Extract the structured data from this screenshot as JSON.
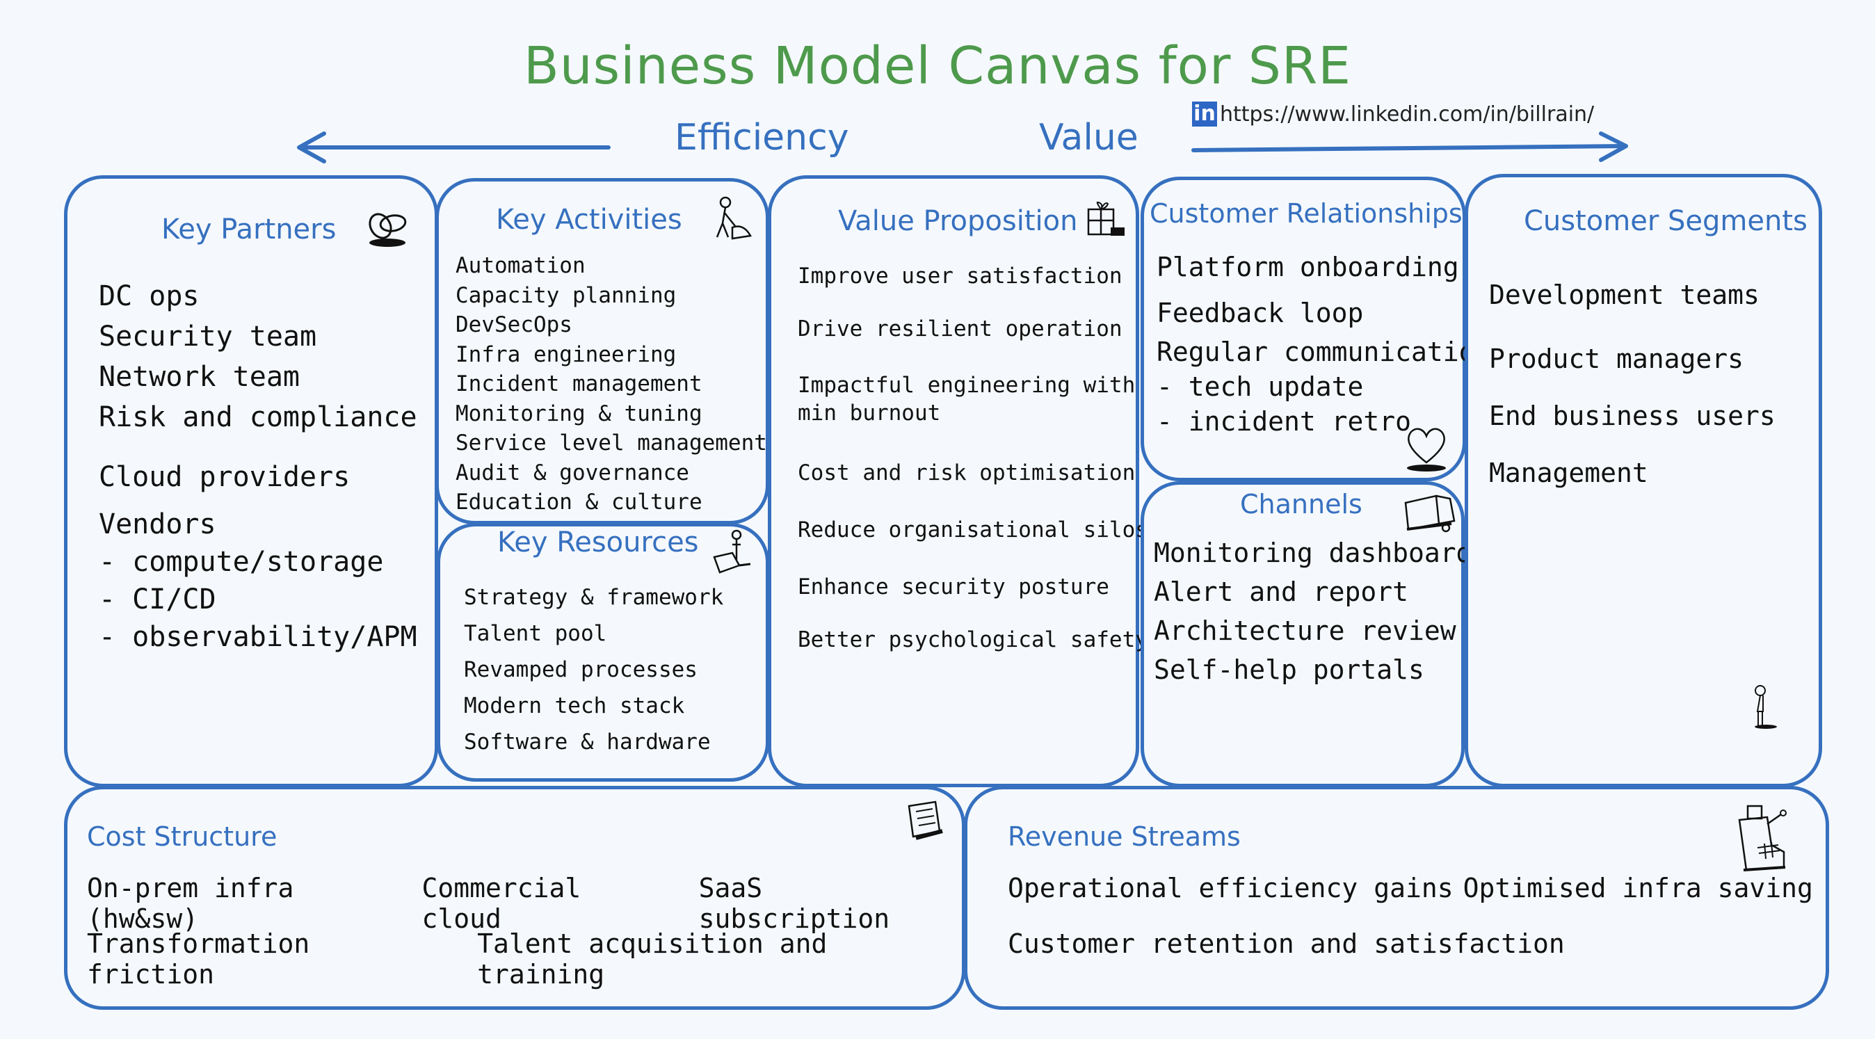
{
  "title": "Business Model Canvas for SRE",
  "axis": {
    "left_label": "Efficiency",
    "right_label": "Value"
  },
  "linkedin": {
    "badge": "in",
    "url": "https://www.linkedin.com/in/billrain/"
  },
  "colors": {
    "box_border": "#3670bf",
    "title": "#4e9a4c",
    "heading": "#3670bf",
    "background": "#f5f9fd",
    "text": "#111111",
    "linkedin": "#2d66c4"
  },
  "key_partners": {
    "heading": "Key Partners",
    "icon": "chain-links-icon",
    "items": [
      "DC ops",
      "Security team",
      "Network team",
      "Risk and compliance"
    ],
    "items2": [
      "Cloud providers"
    ],
    "items3": [
      "Vendors",
      "- compute/storage",
      "- CI/CD",
      "- observability/APM"
    ]
  },
  "key_activities": {
    "heading": "Key Activities",
    "icon": "worker-icon",
    "items": [
      "Automation",
      "Capacity planning",
      "DevSecOps",
      "Infra engineering",
      "Incident management",
      "Monitoring & tuning",
      "Service level management",
      "Audit & governance",
      "Education & culture"
    ]
  },
  "key_resources": {
    "heading": "Key Resources",
    "icon": "person-with-machine-icon",
    "items": [
      "Strategy & framework",
      "Talent pool",
      "Revamped processes",
      "Modern tech stack",
      "Software & hardware"
    ]
  },
  "value_proposition": {
    "heading": "Value Proposition",
    "icon": "gift-icon",
    "items": [
      "Improve user satisfaction",
      "Drive resilient operation",
      "Impactful engineering with\nmin burnout",
      "Cost and risk optimisation",
      "Reduce organisational silos",
      "Enhance security posture",
      "Better psychological safety"
    ]
  },
  "customer_relationships": {
    "heading": "Customer Relationships",
    "icon": "heart-icon",
    "items": [
      "Platform onboarding",
      "Feedback loop"
    ],
    "items2": [
      "Regular communication",
      "- tech update",
      "- incident retro"
    ]
  },
  "channels": {
    "heading": "Channels",
    "icon": "truck-icon",
    "items": [
      "Monitoring dashboard",
      "Alert and report",
      "Architecture review",
      "Self-help portals"
    ]
  },
  "customer_segments": {
    "heading": "Customer Segments",
    "icon": "standing-person-icon",
    "items": [
      "Development teams",
      "Product managers",
      "End business users",
      "Management"
    ]
  },
  "cost_structure": {
    "heading": "Cost Structure",
    "icon": "receipt-icon",
    "row1": [
      "On-prem infra (hw&sw)",
      "Commercial cloud",
      "SaaS subscription"
    ],
    "row2": [
      "Transformation friction",
      "Talent acquisition and training"
    ]
  },
  "revenue_streams": {
    "heading": "Revenue Streams",
    "icon": "cash-register-icon",
    "row1": [
      "Operational efficiency gains",
      "Optimised infra saving"
    ],
    "row2": [
      "Customer retention and satisfaction"
    ]
  }
}
